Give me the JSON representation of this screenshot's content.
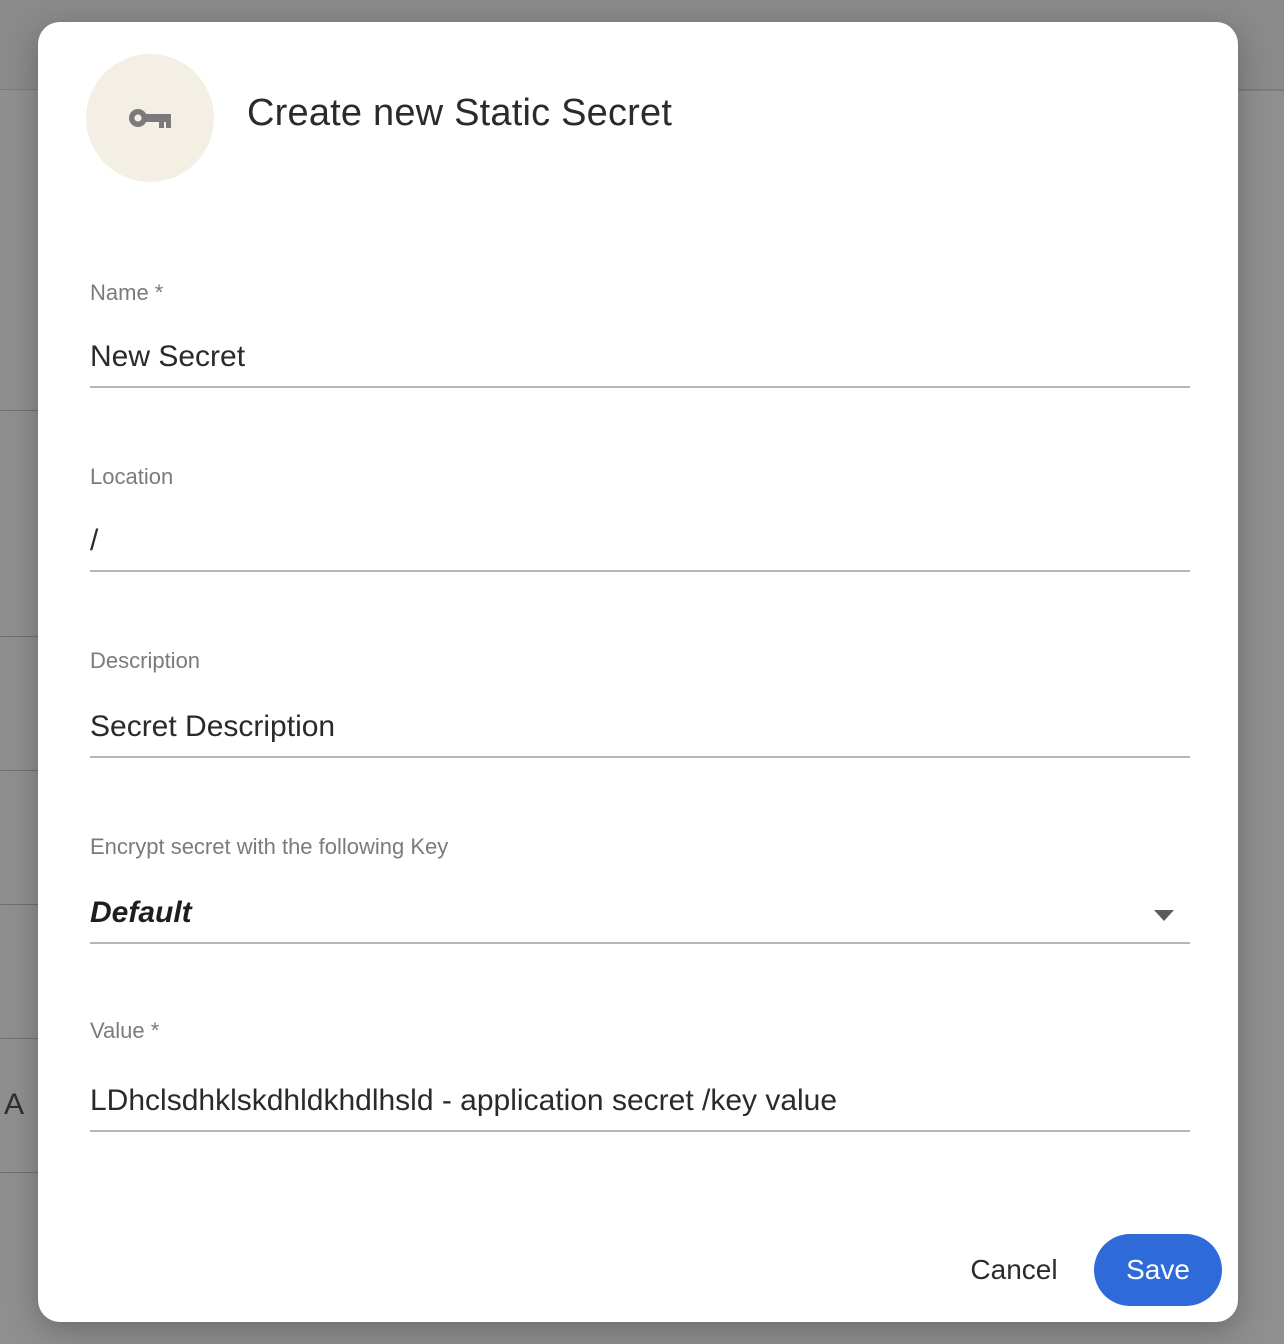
{
  "background": {
    "partial_letter": "A"
  },
  "dialog": {
    "title": "Create new Static Secret",
    "icon": "key-icon",
    "fields": {
      "name": {
        "label": "Name *",
        "value": "New Secret"
      },
      "location": {
        "label": "Location",
        "value": "/"
      },
      "description": {
        "label": "Description",
        "value": "Secret Description"
      },
      "encryption_key": {
        "label": "Encrypt secret with the following Key",
        "value": "Default"
      },
      "value": {
        "label": "Value *",
        "value": "LDhclsdhklskdhldkhdlhsld - application secret /key value"
      }
    },
    "buttons": {
      "cancel": "Cancel",
      "save": "Save"
    }
  },
  "colors": {
    "accent": "#2f6ad9",
    "avatar_bg": "#f3efe4",
    "overlay": "#8f8f8f"
  }
}
